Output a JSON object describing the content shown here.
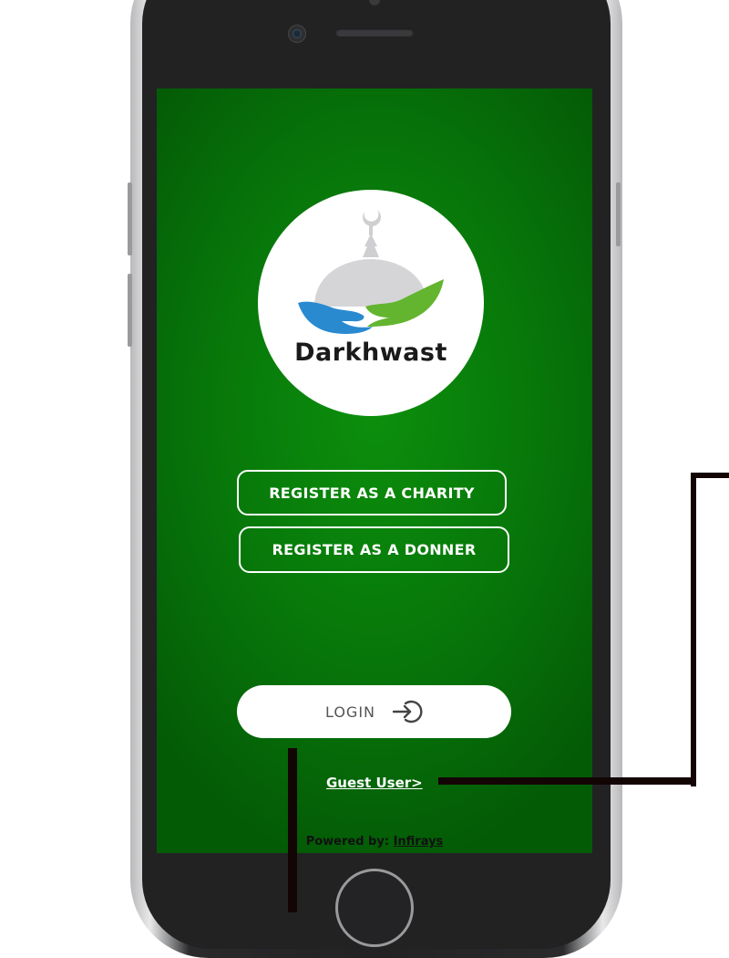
{
  "app": {
    "logo_text": "Darkhwast"
  },
  "actions": {
    "register_charity_label": "REGISTER AS A CHARITY",
    "register_donner_label": "REGISTER AS A DONNER",
    "login_label": "LOGIN",
    "guest_label": "Guest User>"
  },
  "footer": {
    "powered_prefix": "Powered by:",
    "company": "Infirays"
  },
  "colors": {
    "screen_background": "#07760a",
    "button_outline": "#ffffff",
    "login_background": "#ffffff",
    "login_text": "#555555",
    "logo_blue_hand": "#2a8ad0",
    "logo_green_hand": "#63b52f",
    "connector_lines": "#140505"
  },
  "icons": {
    "login": "sign-in-arrow-icon",
    "logo": "mosque-dome-hands-icon"
  }
}
